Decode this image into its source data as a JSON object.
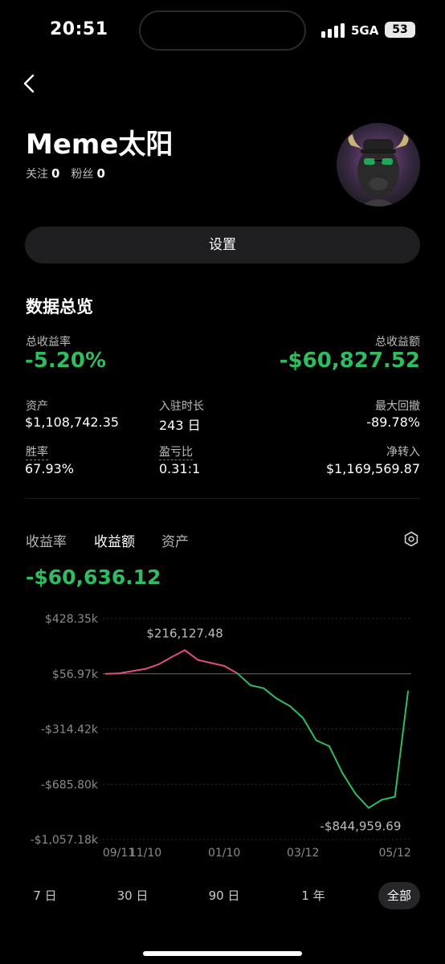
{
  "status_bar": {
    "time": "20:51",
    "network": "5GA",
    "battery": "53"
  },
  "profile": {
    "name": "Meme太阳",
    "following_label": "关注",
    "following_count": "0",
    "followers_label": "粉丝",
    "followers_count": "0",
    "settings_label": "设置"
  },
  "overview": {
    "title": "数据总览",
    "total_return_rate_label": "总收益率",
    "total_return_rate": "-5.20%",
    "total_return_amount_label": "总收益额",
    "total_return_amount": "-$60,827.52",
    "stats": [
      {
        "label": "资产",
        "value": "$1,108,742.35"
      },
      {
        "label": "入驻时长",
        "value": "243 日"
      },
      {
        "label": "最大回撤",
        "value": "-89.78%"
      },
      {
        "label": "胜率",
        "value": "67.93%"
      },
      {
        "label": "盈亏比",
        "value": "0.31:1"
      },
      {
        "label": "净转入",
        "value": "$1,169,569.87"
      }
    ]
  },
  "chart_tabs": [
    "收益率",
    "收益额",
    "资产"
  ],
  "active_chart_tab": "收益额",
  "chart_current_value": "-$60,636.12",
  "ranges": [
    "7 日",
    "30 日",
    "90 日",
    "1 年",
    "全部"
  ],
  "active_range": "全部",
  "colors": {
    "positive": "#2fbd5f",
    "negative": "#e0507a",
    "background": "#000000"
  },
  "chart_data": {
    "type": "line",
    "title": "",
    "xlabel": "",
    "ylabel": "",
    "y_ticks": [
      "$428.35k",
      "$56.97k",
      "-$314.42k",
      "-$685.80k",
      "-$1,057.18k"
    ],
    "x_ticks": [
      "09/11",
      "11/10",
      "01/10",
      "03/12",
      "05/12"
    ],
    "ylim": [
      -1057180,
      428350
    ],
    "max_label": "$216,127.48",
    "min_label": "-$844,959.69",
    "x": [
      "09/11",
      "10/01",
      "10/20",
      "11/10",
      "11/25",
      "12/05",
      "12/12",
      "12/20",
      "01/01",
      "01/10",
      "01/20",
      "02/01",
      "02/12",
      "02/22",
      "03/05",
      "03/12",
      "03/22",
      "04/01",
      "04/12",
      "04/20",
      "05/01",
      "05/07",
      "05/12",
      "05/15"
    ],
    "series": [
      {
        "values": [
          56970,
          60000,
          75000,
          90000,
          120000,
          170000,
          216127,
          150000,
          130000,
          110000,
          60000,
          -20000,
          -40000,
          -110000,
          -160000,
          -240000,
          -390000,
          -430000,
          -610000,
          -750000,
          -845000,
          -790000,
          -770000,
          -60636
        ]
      }
    ]
  }
}
